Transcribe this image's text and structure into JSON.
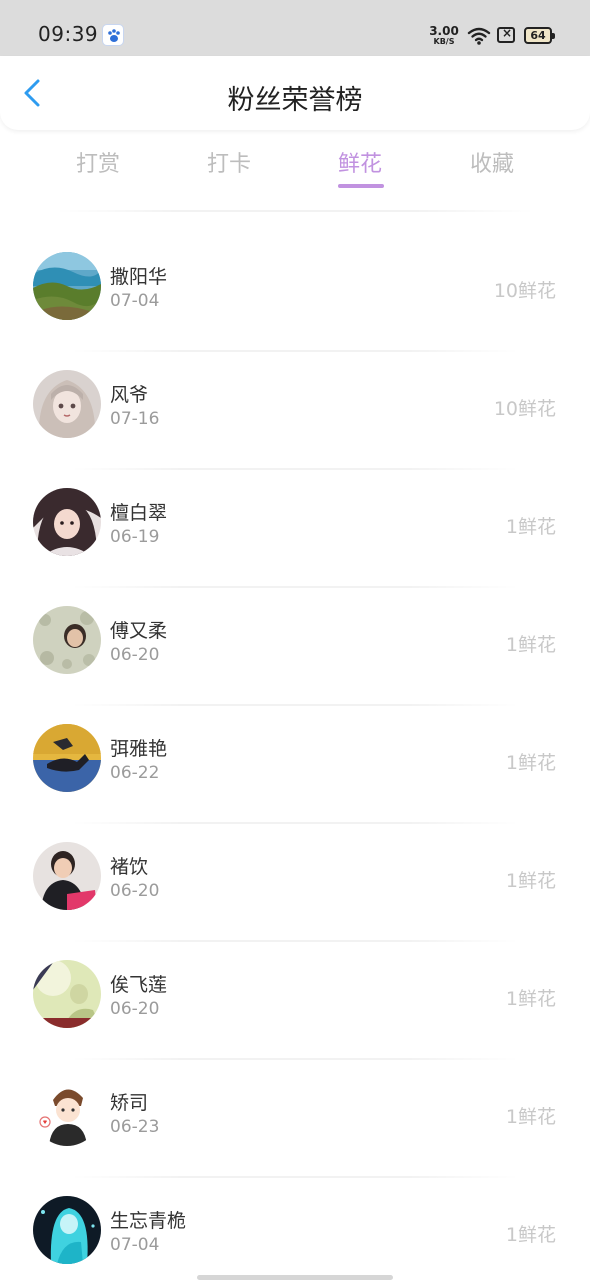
{
  "status_bar": {
    "time": "09:39",
    "app_badge_icon": "baidu-paw-icon",
    "net_speed_value": "3.00",
    "net_speed_unit": "KB/S",
    "wifi_icon": "wifi-icon",
    "sim_icon": "no-sim-icon",
    "battery_level": "64"
  },
  "nav": {
    "back_icon": "chevron-left-icon",
    "title": "粉丝荣誉榜",
    "accent_color": "#2e9cf0"
  },
  "tabs": [
    {
      "label": "打赏",
      "active": false
    },
    {
      "label": "打卡",
      "active": false
    },
    {
      "label": "鲜花",
      "active": true
    },
    {
      "label": "收藏",
      "active": false
    }
  ],
  "active_tab_color": "#c192e0",
  "fans": [
    {
      "name": "撒阳华",
      "date": "07-04",
      "amount": "10鲜花",
      "avatar": "avatar-landscape"
    },
    {
      "name": "风爷",
      "date": "07-16",
      "amount": "10鲜花",
      "avatar": "avatar-anime-girl"
    },
    {
      "name": "檀白翠",
      "date": "06-19",
      "amount": "1鲜花",
      "avatar": "avatar-woman-selfie"
    },
    {
      "name": "傅又柔",
      "date": "06-20",
      "amount": "1鲜花",
      "avatar": "avatar-face-pattern"
    },
    {
      "name": "弭雅艳",
      "date": "06-22",
      "amount": "1鲜花",
      "avatar": "avatar-figure-blue-yellow"
    },
    {
      "name": "褚饮",
      "date": "06-20",
      "amount": "1鲜花",
      "avatar": "avatar-person-pink"
    },
    {
      "name": "俟飞莲",
      "date": "06-20",
      "amount": "1鲜花",
      "avatar": "avatar-soft-green"
    },
    {
      "name": "矫司",
      "date": "06-23",
      "amount": "1鲜花",
      "avatar": "avatar-cartoon-boy"
    },
    {
      "name": "生忘青桅",
      "date": "07-04",
      "amount": "1鲜花",
      "avatar": "avatar-cyan-figure"
    }
  ]
}
